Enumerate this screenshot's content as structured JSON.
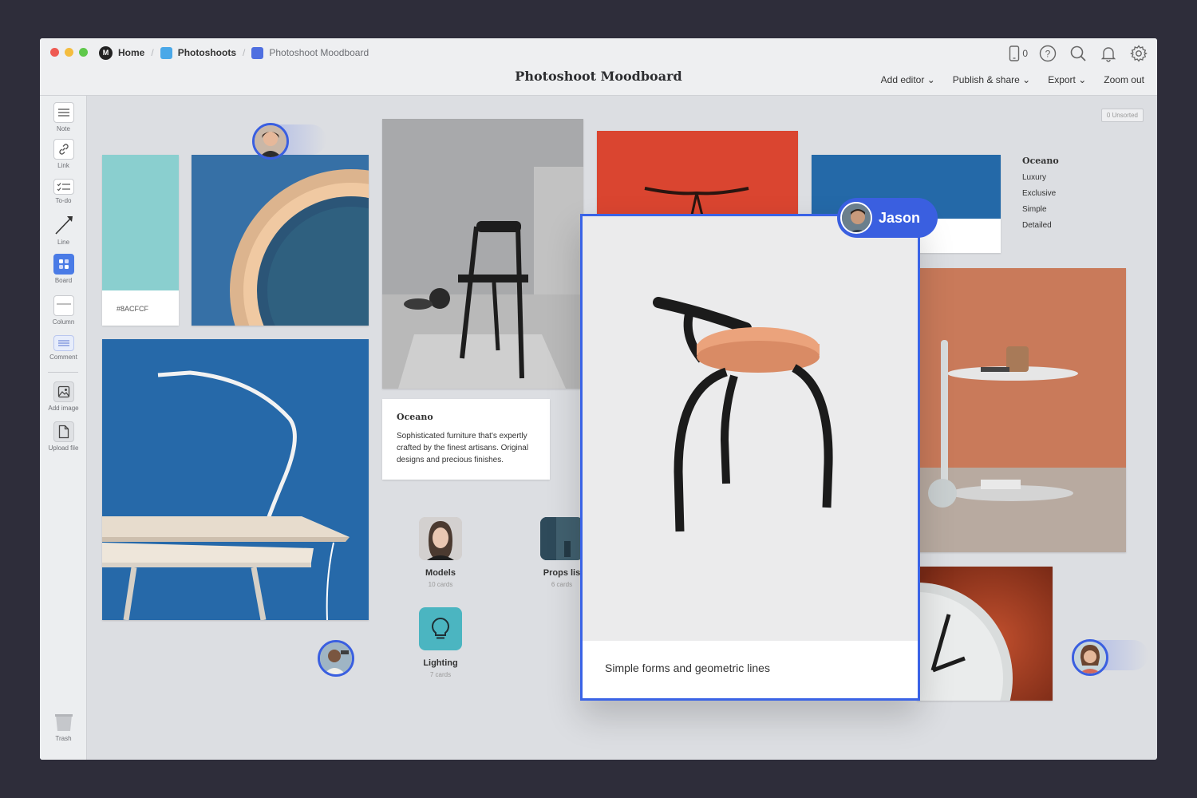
{
  "breadcrumb": {
    "home": "Home",
    "photoshoots": "Photoshoots",
    "current": "Photoshoot Moodboard"
  },
  "document_title": "Photoshoot Moodboard",
  "device_count": "0",
  "top_menu": {
    "add_editor": "Add editor",
    "publish_share": "Publish & share",
    "export": "Export",
    "zoom_out": "Zoom out"
  },
  "toolbar": {
    "note": "Note",
    "link": "Link",
    "todo": "To-do",
    "line": "Line",
    "board": "Board",
    "column": "Column",
    "comment": "Comment",
    "add_image": "Add image",
    "upload_file": "Upload file",
    "trash": "Trash"
  },
  "canvas": {
    "unsorted": "0 Unsorted",
    "swatch_hex": "#8ACFCF",
    "swatch_color": "#8ACFCF",
    "oceano_note": {
      "title": "Oceano",
      "body": "Sophisticated furniture that's expertly crafted by the finest artisans. Original designs and precious finishes."
    },
    "oceano_tags": {
      "title": "Oceano",
      "items": [
        "Luxury",
        "Exclusive",
        "Simple",
        "Detailed"
      ]
    },
    "boards": [
      {
        "name": "Models",
        "count": "10 cards"
      },
      {
        "name": "Props lis",
        "count": "6 cards"
      },
      {
        "name": "Lighting",
        "count": "7 cards"
      }
    ],
    "focus_caption": "Simple forms and geometric lines",
    "collaborator": "Jason"
  },
  "colors": {
    "accent": "#3a5fe0",
    "teal": "#4bb5c1",
    "blue_bg": "#2469a8",
    "red_bg": "#d9432c",
    "terracotta": "#c97a5a"
  }
}
